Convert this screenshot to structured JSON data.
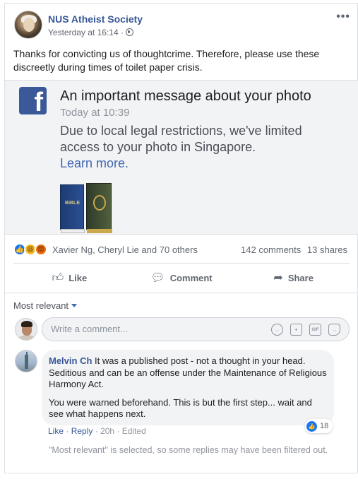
{
  "post": {
    "page_name": "NUS Atheist Society",
    "time": "Yesterday at 16:14 ·",
    "more_icon": "•••",
    "text": "Thanks for convicting us of thoughtcrime. Therefore, please use these discreetly during times of toilet paper crisis."
  },
  "shared_message": {
    "logo_letter": "f",
    "title": "An important message about your photo",
    "time": "Today at 10:39",
    "body": "Due to local legal restrictions, we've limited access to your photo in Singapore.",
    "link": "Learn more.",
    "book_title": "BIBLE"
  },
  "reactions": {
    "icons": [
      "like-icon",
      "haha-icon",
      "angry-icon"
    ],
    "names": "Xavier Ng, Cheryl Lie and 70 others",
    "comments": "142 comments",
    "shares": "13 shares"
  },
  "actions": {
    "like": "Like",
    "comment": "Comment",
    "share": "Share"
  },
  "comments_section": {
    "sort_label": "Most relevant",
    "input_placeholder": "Write a comment...",
    "comment": {
      "author": "Melvin Ch",
      "paragraph1": " It was a published post - not a thought in your head. Seditious and can be an offense under the Maintenance of Religious Harmony Act.",
      "paragraph2": "You were warned beforehand. This is but the first step... wait and see what happens next.",
      "like_count": "18",
      "like_label": "Like",
      "reply_label": "Reply",
      "age": "20h",
      "edited": "Edited"
    },
    "notice": "\"Most relevant\" is selected, so some replies may have been filtered out."
  },
  "colors": {
    "link_blue": "#385898",
    "facebook_blue": "#3b5998",
    "like_blue": "#1877f2"
  }
}
